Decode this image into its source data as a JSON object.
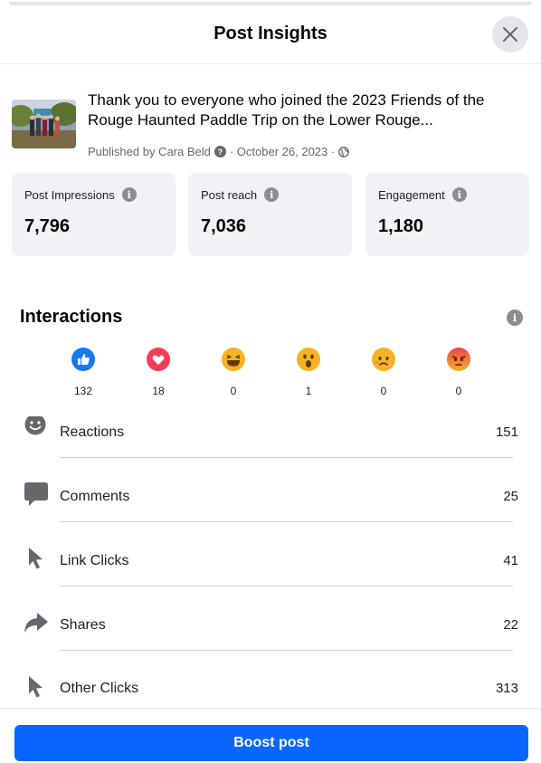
{
  "header": {
    "title": "Post Insights"
  },
  "post": {
    "text": "Thank you to everyone who joined the 2023 Friends of the Rouge Haunted Paddle Trip on the Lower Rouge...",
    "meta_prefix": "Published by Cara Beld",
    "meta_date": "· October 26, 2023 ·"
  },
  "metrics": [
    {
      "label": "Post Impressions",
      "value": "7,796"
    },
    {
      "label": "Post reach",
      "value": "7,036"
    },
    {
      "label": "Engagement",
      "value": "1,180"
    }
  ],
  "interactions": {
    "title": "Interactions",
    "reactions": [
      {
        "icon": "like-icon",
        "count": "132",
        "color": "#1877f2"
      },
      {
        "icon": "love-icon",
        "count": "18",
        "color": "#f33e58"
      },
      {
        "icon": "haha-icon",
        "count": "0",
        "color": "#f7b125"
      },
      {
        "icon": "wow-icon",
        "count": "1",
        "color": "#f7b125"
      },
      {
        "icon": "sad-icon",
        "count": "0",
        "color": "#f7b125"
      },
      {
        "icon": "angry-icon",
        "count": "0",
        "color": "#e9710f"
      }
    ],
    "rows": [
      {
        "icon": "smiley-icon",
        "label": "Reactions",
        "value": "151"
      },
      {
        "icon": "comment-icon",
        "label": "Comments",
        "value": "25"
      },
      {
        "icon": "cursor-icon",
        "label": "Link Clicks",
        "value": "41"
      },
      {
        "icon": "share-icon",
        "label": "Shares",
        "value": "22"
      },
      {
        "icon": "cursor-icon",
        "label": "Other Clicks",
        "value": "313"
      }
    ]
  },
  "footer": {
    "boost_label": "Boost post"
  },
  "colors": {
    "accent": "#0866ff",
    "card_bg": "#f0f2f5",
    "icon_gray": "#65676b"
  }
}
